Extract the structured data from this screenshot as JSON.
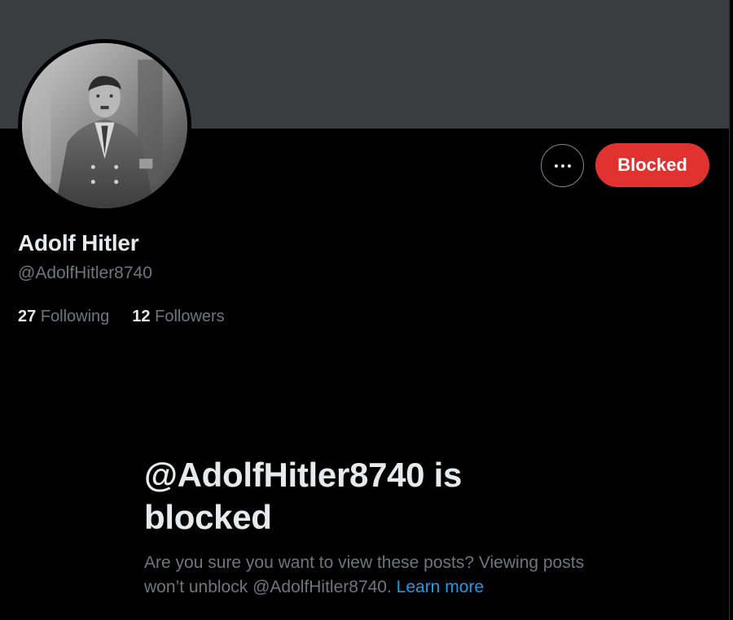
{
  "profile": {
    "display_name": "Adolf Hitler",
    "handle": "@AdolfHitler8740",
    "following_count": "27",
    "following_label": "Following",
    "followers_count": "12",
    "followers_label": "Followers"
  },
  "actions": {
    "more_icon": "more-horizontal-icon",
    "blocked_label": "Blocked"
  },
  "blocked_notice": {
    "title": "@AdolfHitler8740 is blocked",
    "description": "Are you sure you want to view these posts? Viewing posts won’t unblock @AdolfHitler8740. ",
    "learn_more": "Learn more"
  },
  "colors": {
    "banner": "#3b3c40",
    "blocked_button": "#e0332f",
    "link": "#1d9bf0",
    "muted_text": "#71767b"
  }
}
